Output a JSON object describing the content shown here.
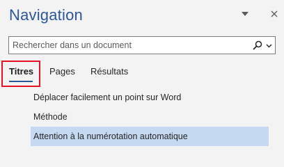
{
  "pane": {
    "title": "Navigation",
    "icons": {
      "dropdown": "chevron-down-icon",
      "close": "close-icon"
    }
  },
  "search": {
    "placeholder": "Rechercher dans un document",
    "value": "",
    "icons": {
      "search": "search-icon",
      "options": "chevron-down-icon"
    }
  },
  "tabs": [
    {
      "label": "Titres",
      "active": true
    },
    {
      "label": "Pages",
      "active": false
    },
    {
      "label": "Résultats",
      "active": false
    }
  ],
  "headings": [
    {
      "label": "Déplacer facilement un point sur Word",
      "selected": false
    },
    {
      "label": "Méthode",
      "selected": false
    },
    {
      "label": "Attention à la numérotation automatique",
      "selected": true
    }
  ],
  "colors": {
    "accent": "#2b579a",
    "selection": "#c5d9f1",
    "highlight_box": "#e81123",
    "background": "#f3f3f3"
  }
}
